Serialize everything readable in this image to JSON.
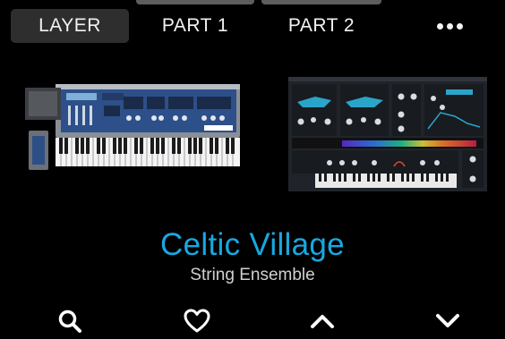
{
  "tabs": [
    {
      "label": "LAYER",
      "active": true
    },
    {
      "label": "PART 1",
      "active": false
    },
    {
      "label": "PART 2",
      "active": false
    }
  ],
  "more_icon": "more-horizontal-icon",
  "instruments": [
    {
      "icon": "synth-hardware-image",
      "selected": true
    },
    {
      "icon": "synth-software-image",
      "selected": false
    }
  ],
  "preset": {
    "name": "Celtic Village",
    "type": "String Ensemble"
  },
  "actions": [
    {
      "icon": "search-icon"
    },
    {
      "icon": "heart-icon"
    },
    {
      "icon": "chevron-up-icon"
    },
    {
      "icon": "chevron-down-icon"
    }
  ],
  "colors": {
    "accent": "#18a8e0",
    "active_tab_bg": "#2e2e2e",
    "background": "#000000"
  }
}
